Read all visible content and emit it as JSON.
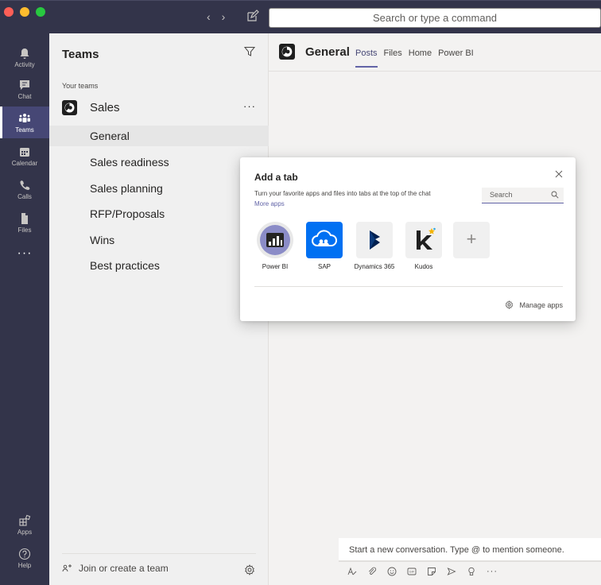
{
  "search": {
    "placeholder": "Search or type a command"
  },
  "rail": {
    "items": [
      {
        "label": "Activity",
        "icon": "bell-icon"
      },
      {
        "label": "Chat",
        "icon": "chat-icon"
      },
      {
        "label": "Teams",
        "icon": "teams-icon",
        "active": true
      },
      {
        "label": "Calendar",
        "icon": "calendar-icon"
      },
      {
        "label": "Calls",
        "icon": "phone-icon"
      },
      {
        "label": "Files",
        "icon": "file-icon"
      }
    ],
    "more": "···",
    "apps_label": "Apps",
    "help_label": "Help"
  },
  "teams_pane": {
    "title": "Teams",
    "section": "Your teams",
    "team_name": "Sales",
    "team_more": "···",
    "channels": [
      "General",
      "Sales readiness",
      "Sales planning",
      "RFP/Proposals",
      "Wins",
      "Best practices"
    ],
    "join_label": "Join or create a team"
  },
  "channel": {
    "title": "General",
    "tabs": [
      "Posts",
      "Files",
      "Home",
      "Power BI"
    ]
  },
  "compose": {
    "placeholder": "Start a new conversation. Type @ to mention someone.",
    "more": "···"
  },
  "dialog": {
    "title": "Add a tab",
    "subtitle": "Turn your favorite apps and files into tabs at the top of the chat",
    "more_apps": "More apps",
    "search_placeholder": "Search",
    "apps": [
      "Power BI",
      "SAP",
      "Dynamics 365",
      "Kudos"
    ],
    "add_symbol": "+",
    "manage_label": "Manage apps"
  },
  "colors": {
    "rail": "#33344a",
    "accent": "#6264a7",
    "sap_blue": "#0070f2",
    "dynamics_navy": "#002050"
  }
}
